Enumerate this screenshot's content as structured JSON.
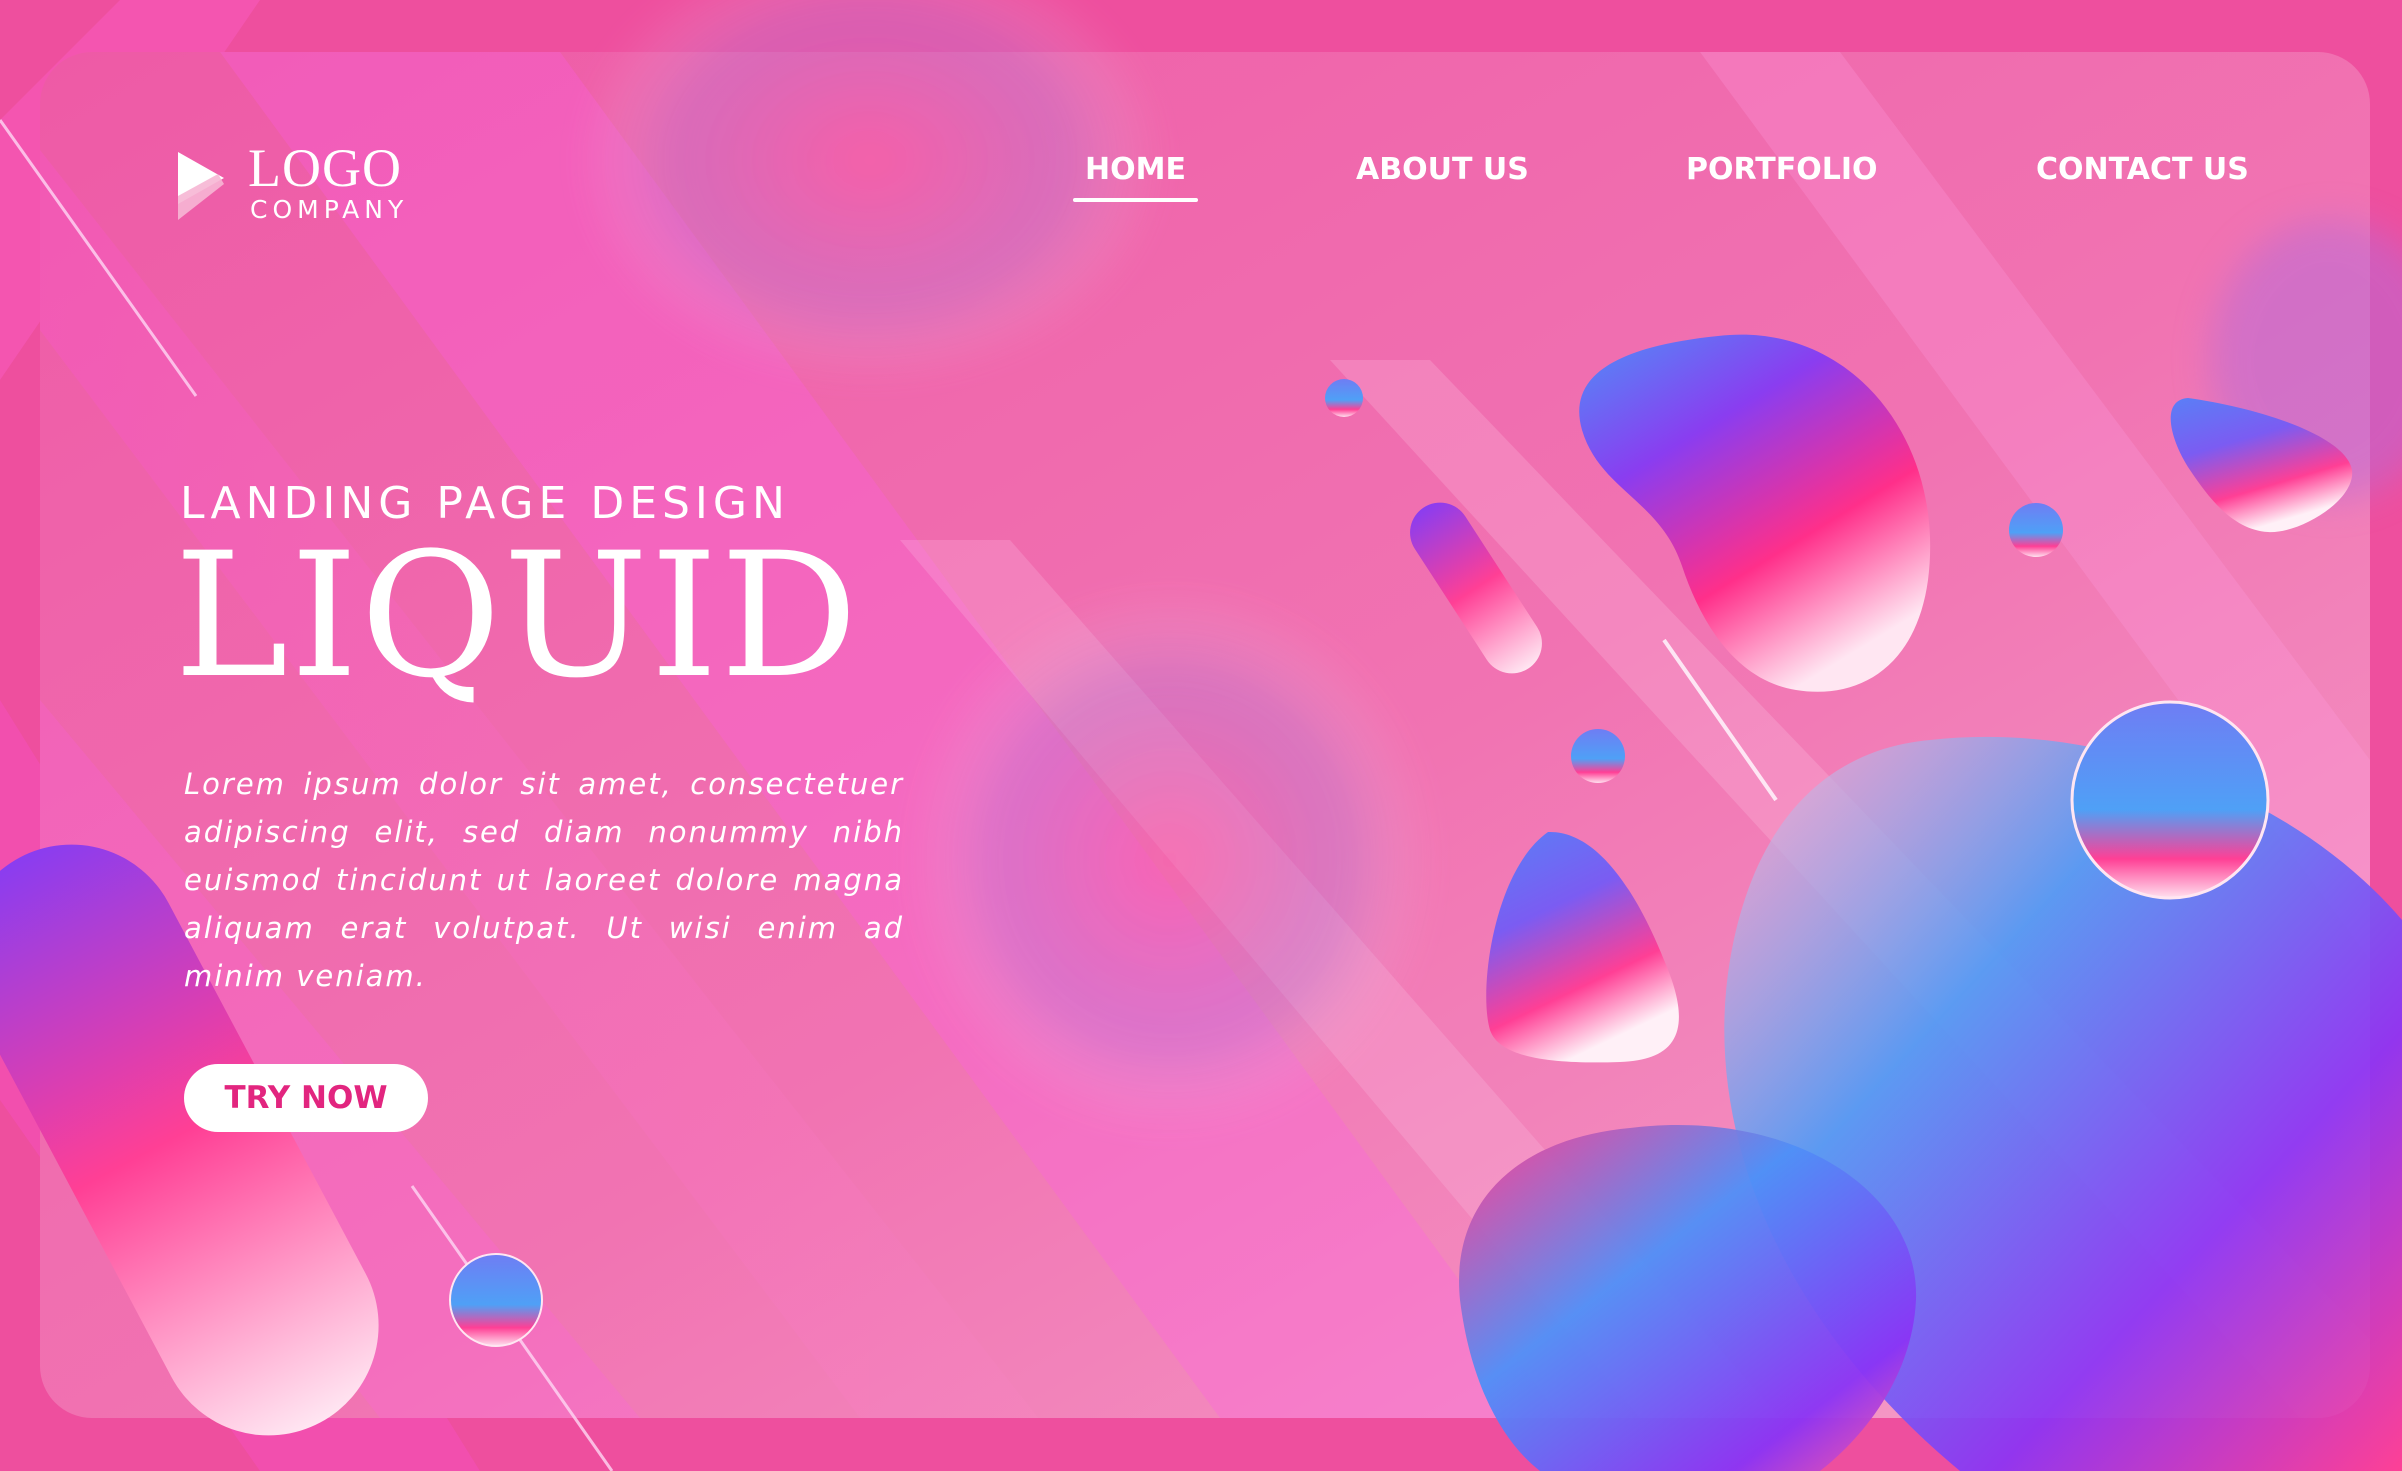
{
  "brand": {
    "logo_text": "LOGO",
    "company_text": "COMPANY"
  },
  "nav": {
    "items": [
      {
        "label": "HOME",
        "active": true
      },
      {
        "label": "ABOUT US",
        "active": false
      },
      {
        "label": "PORTFOLIO",
        "active": false
      },
      {
        "label": "CONTACT US",
        "active": false
      }
    ]
  },
  "hero": {
    "kicker": "LANDING PAGE DESIGN",
    "headline": "LIQUID",
    "body": "Lorem ipsum dolor sit amet, consectetuer adipiscing elit, sed diam nonummy nibh euismod tincidunt ut laoreet dolore magna aliquam erat volutpat. Ut wisi enim ad minim veniam.",
    "cta_label": "TRY NOW"
  },
  "colors": {
    "background": "#ee4f9e",
    "accent": "#e2257f",
    "blob_blue": "#4f8ff7",
    "blob_purple": "#8a3df0",
    "blob_pink": "#ff2f8a"
  },
  "icons": {
    "logo_mark": "play-triangle-icon"
  }
}
